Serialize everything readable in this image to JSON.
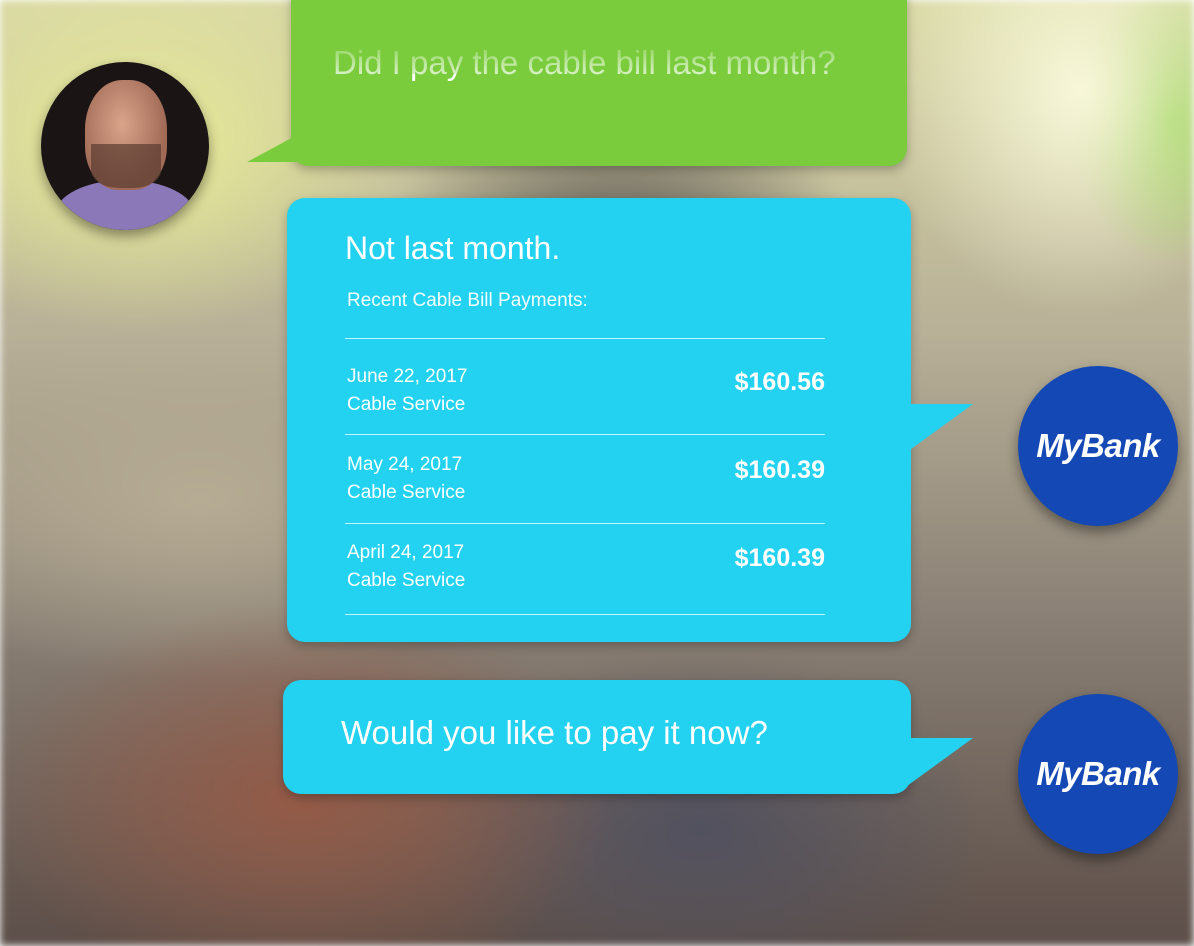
{
  "messages": {
    "user_question": "Did I pay the cable bill last month?",
    "bank_reply_title": "Not last month.",
    "bank_reply_subtitle": "Recent Cable Bill Payments:",
    "payments": [
      {
        "date": "June 22, 2017",
        "description": "Cable Service",
        "amount": "$160.56"
      },
      {
        "date": "May 24, 2017",
        "description": "Cable Service",
        "amount": "$160.39"
      },
      {
        "date": "April 24, 2017",
        "description": "Cable Service",
        "amount": "$160.39"
      }
    ],
    "bank_followup": "Would you like to pay it now?"
  },
  "bank": {
    "logo_text": "MyBank"
  },
  "colors": {
    "user_bubble": "#7acc3c",
    "bank_bubble": "#22d2f0",
    "bank_logo": "#1448b4"
  },
  "icons": {
    "user_avatar": "user-photo-avatar",
    "bank_avatar": "mybank-logo"
  }
}
